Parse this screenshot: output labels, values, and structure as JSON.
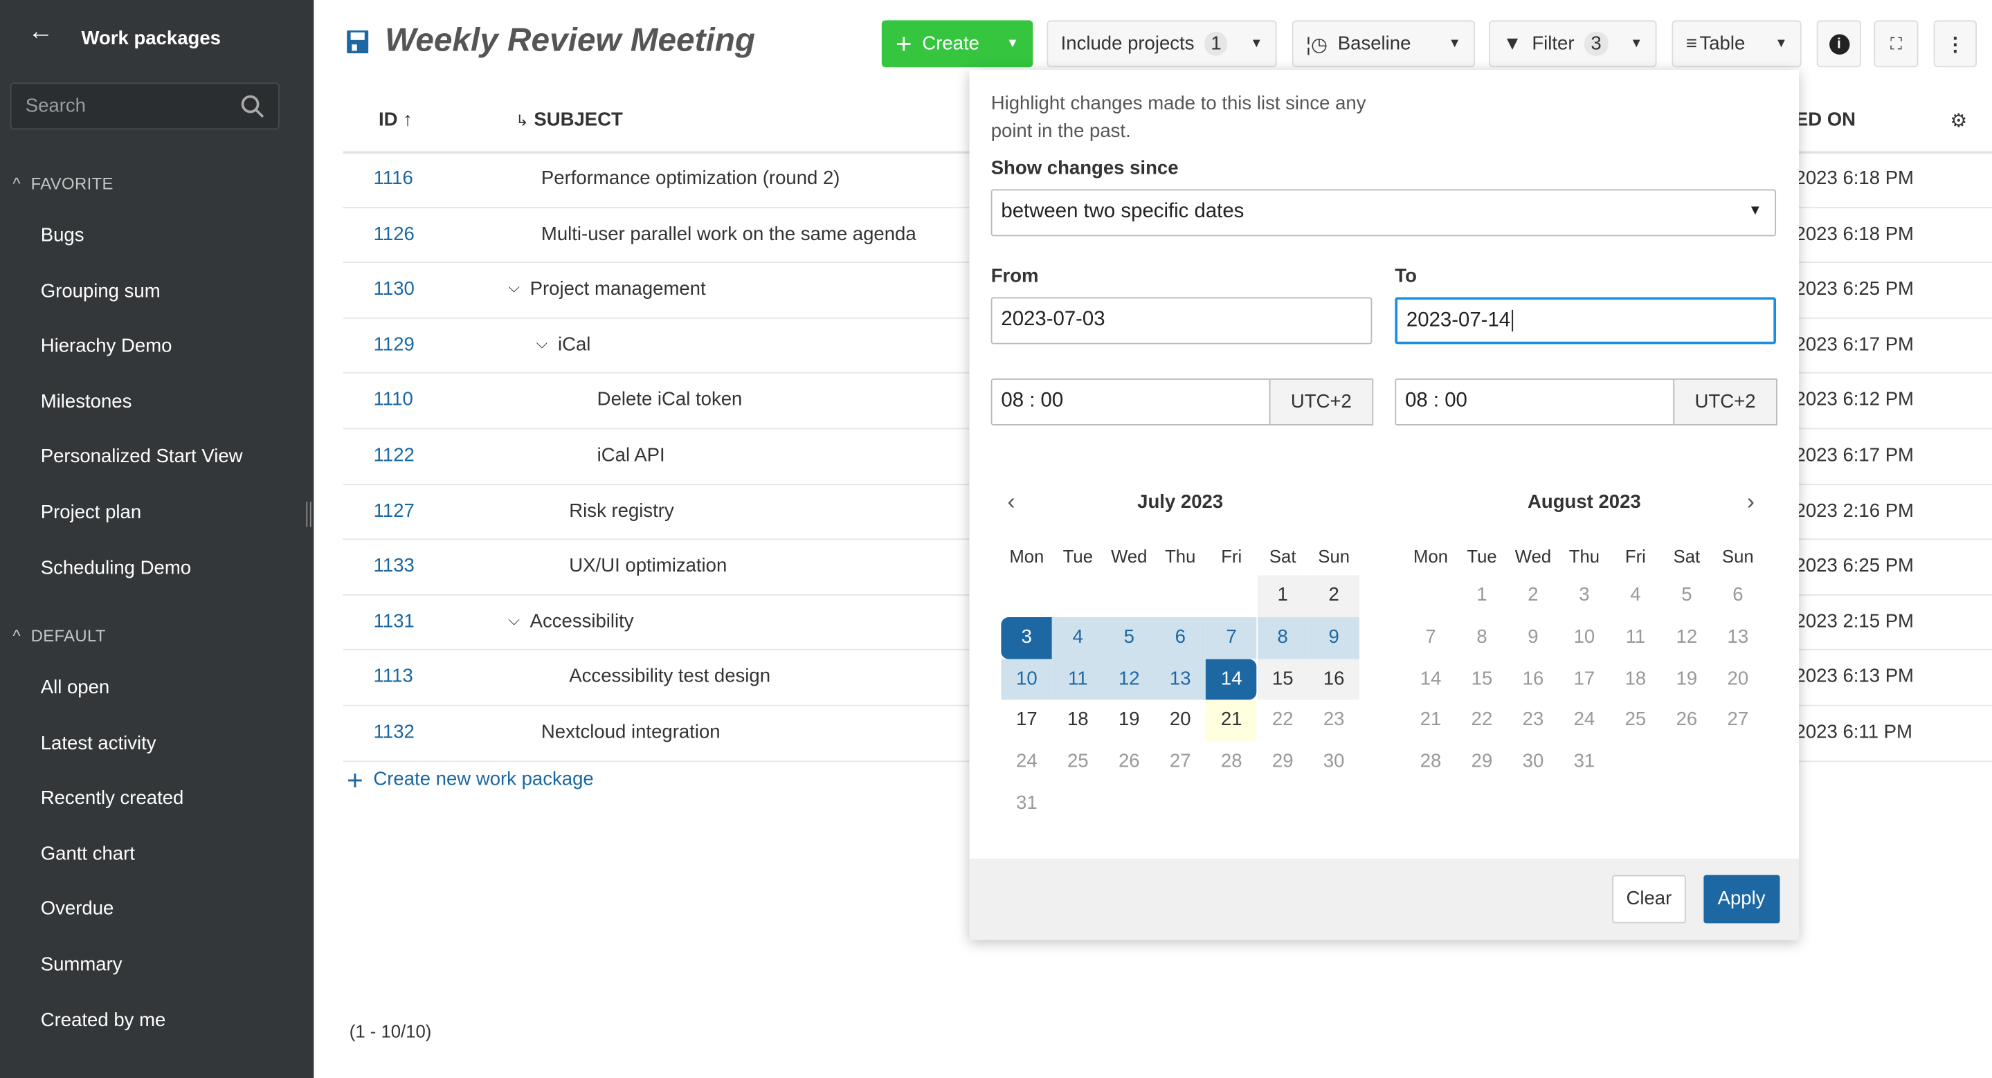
{
  "sidebar": {
    "title": "Work packages",
    "search_placeholder": "Search",
    "sections": [
      {
        "label": "FAVORITE",
        "items": [
          "Bugs",
          "Grouping sum",
          "Hierachy Demo",
          "Milestones",
          "Personalized Start View",
          "Project plan",
          "Scheduling Demo"
        ]
      },
      {
        "label": "DEFAULT",
        "items": [
          "All open",
          "Latest activity",
          "Recently created",
          "Gantt chart",
          "Overdue",
          "Summary",
          "Created by me"
        ]
      }
    ]
  },
  "header": {
    "title": "Weekly Review Meeting",
    "create": "Create",
    "include_projects": "Include projects",
    "include_projects_count": "1",
    "baseline": "Baseline",
    "filter": "Filter",
    "filter_count": "3",
    "view": "Table"
  },
  "table": {
    "columns": {
      "id": "ID",
      "subject": "SUBJECT",
      "updated": "TED ON"
    },
    "rows": [
      {
        "id": "1116",
        "subject": "Performance optimization (round 2)",
        "level": 0,
        "toggle": false,
        "updated": "2023 6:18 PM"
      },
      {
        "id": "1126",
        "subject": "Multi-user parallel work on the same agenda",
        "level": 0,
        "toggle": false,
        "updated": "2023 6:18 PM"
      },
      {
        "id": "1130",
        "subject": "Project management",
        "level": 0,
        "toggle": true,
        "updated": "2023 6:25 PM"
      },
      {
        "id": "1129",
        "subject": "iCal",
        "level": 1,
        "toggle": true,
        "updated": "2023 6:17 PM"
      },
      {
        "id": "1110",
        "subject": "Delete iCal token",
        "level": 2,
        "toggle": false,
        "updated": "2023 6:12 PM"
      },
      {
        "id": "1122",
        "subject": "iCal API",
        "level": 2,
        "toggle": false,
        "updated": "2023 6:17 PM"
      },
      {
        "id": "1127",
        "subject": "Risk registry",
        "level": 1,
        "toggle": false,
        "updated": "2023 2:16 PM"
      },
      {
        "id": "1133",
        "subject": "UX/UI optimization",
        "level": 1,
        "toggle": false,
        "updated": "2023 6:25 PM"
      },
      {
        "id": "1131",
        "subject": "Accessibility",
        "level": 0,
        "toggle": true,
        "updated": "2023 2:15 PM"
      },
      {
        "id": "1113",
        "subject": "Accessibility test design",
        "level": 1,
        "toggle": false,
        "updated": "2023 6:13 PM"
      },
      {
        "id": "1132",
        "subject": "Nextcloud integration",
        "level": 0,
        "toggle": false,
        "updated": "2023 6:11 PM"
      }
    ],
    "create_new": "Create new work package",
    "pagination": "(1 - 10/10)"
  },
  "baseline": {
    "description": "Highlight changes made to this list since any point in the past.",
    "show_changes_label": "Show changes since",
    "mode": "between two specific dates",
    "from_label": "From",
    "to_label": "To",
    "from_date": "2023-07-03",
    "to_date": "2023-07-14",
    "from_time": "08 : 00",
    "to_time": "08 : 00",
    "from_tz": "UTC+2",
    "to_tz": "UTC+2",
    "weekdays": [
      "Mon",
      "Tue",
      "Wed",
      "Thu",
      "Fri",
      "Sat",
      "Sun"
    ],
    "months": [
      {
        "name": "July 2023",
        "weeks": [
          [
            "",
            "",
            "",
            "",
            "",
            "1",
            "2"
          ],
          [
            "3",
            "4",
            "5",
            "6",
            "7",
            "8",
            "9"
          ],
          [
            "10",
            "11",
            "12",
            "13",
            "14",
            "15",
            "16"
          ],
          [
            "17",
            "18",
            "19",
            "20",
            "21",
            "22",
            "23"
          ],
          [
            "24",
            "25",
            "26",
            "27",
            "28",
            "29",
            "30"
          ],
          [
            "31",
            "",
            "",
            "",
            "",
            "",
            ""
          ]
        ]
      },
      {
        "name": "August 2023",
        "weeks": [
          [
            "",
            "1",
            "2",
            "3",
            "4",
            "5",
            "6"
          ],
          [
            "7",
            "8",
            "9",
            "10",
            "11",
            "12",
            "13"
          ],
          [
            "14",
            "15",
            "16",
            "17",
            "18",
            "19",
            "20"
          ],
          [
            "21",
            "22",
            "23",
            "24",
            "25",
            "26",
            "27"
          ],
          [
            "28",
            "29",
            "30",
            "31",
            "",
            "",
            ""
          ]
        ]
      }
    ],
    "range_start": 3,
    "range_end": 14,
    "today": 21,
    "clear": "Clear",
    "apply": "Apply"
  },
  "colors": {
    "primary": "#1d67a3",
    "range": "#d0e1ee",
    "create": "#35c53f",
    "today": "#ffffe0",
    "weekend": "#f2f2f2"
  }
}
